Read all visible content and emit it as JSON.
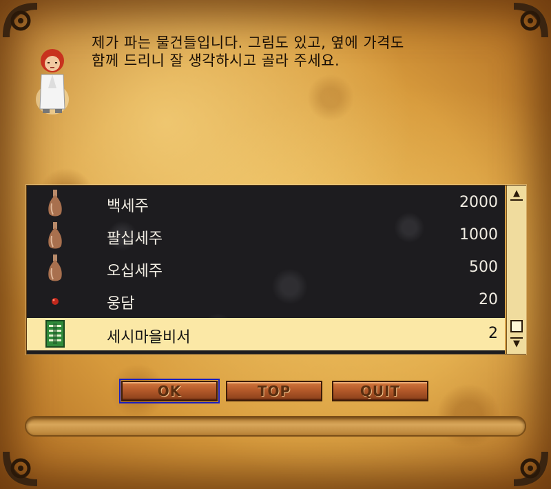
{
  "dialogue": {
    "line1": "제가 파는 물건들입니다. 그림도 있고, 옆에 가격도",
    "line2": "함께 드리니 잘 생각하시고 골라 주세요."
  },
  "items": [
    {
      "name": "백세주",
      "price": "2000",
      "icon": "wine-bottle-icon",
      "selected": false
    },
    {
      "name": "팔십세주",
      "price": "1000",
      "icon": "wine-bottle-icon",
      "selected": false
    },
    {
      "name": "오십세주",
      "price": "500",
      "icon": "wine-bottle-icon",
      "selected": false
    },
    {
      "name": "웅담",
      "price": "20",
      "icon": "bear-bile-icon",
      "selected": false
    },
    {
      "name": "세시마을비서",
      "price": "2",
      "icon": "scroll-icon",
      "selected": true
    }
  ],
  "buttons": {
    "ok": "OK",
    "top": "TOP",
    "quit": "QUIT"
  },
  "scrollbar": {
    "up": "▲",
    "down": "▼"
  },
  "colors": {
    "parchment": "#d79a3c",
    "list_background": "#1d1c1f",
    "selected_row": "#fbe8a6",
    "button": "#b45a2a",
    "focus_outline": "#1a1fbf"
  }
}
